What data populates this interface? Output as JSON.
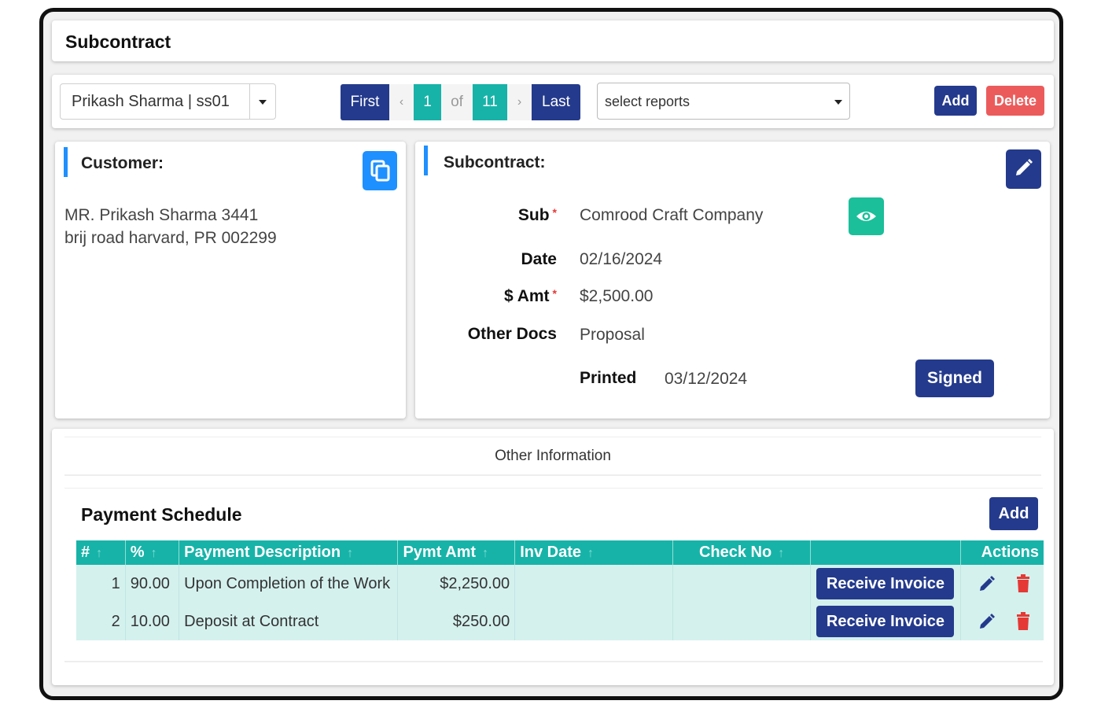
{
  "header": {
    "title": "Subcontract"
  },
  "toolbar": {
    "customer_select": "Prikash Sharma | ss01",
    "pagination": {
      "first": "First",
      "prev": "‹",
      "current": "1",
      "of": "of",
      "total": "11",
      "next": "›",
      "last": "Last"
    },
    "reports_placeholder": "select reports",
    "add_label": "Add",
    "delete_label": "Delete"
  },
  "customer": {
    "heading": "Customer:",
    "address_line1": "MR. Prikash Sharma 3441",
    "address_line2": "brij road harvard, PR 002299"
  },
  "subcontract": {
    "heading": "Subcontract:",
    "sub_label": "Sub",
    "sub_value": "Comrood Craft Company",
    "date_label": "Date",
    "date_value": "02/16/2024",
    "amt_label": "$ Amt",
    "amt_value": "$2,500.00",
    "docs_label": "Other Docs",
    "docs_value": "Proposal",
    "printed_label": "Printed",
    "printed_value": "03/12/2024",
    "signed_label": "Signed",
    "required_mark": "*"
  },
  "other_info": {
    "label": "Other Information"
  },
  "payment_schedule": {
    "title": "Payment Schedule",
    "add_label": "Add",
    "columns": [
      "#",
      "%",
      "Payment Description",
      "Pymt Amt",
      "Inv Date",
      "Check No",
      "",
      "Actions"
    ],
    "rows": [
      {
        "num": "1",
        "pct": "90.00",
        "desc": "Upon Completion of the Work",
        "amt": "$2,250.00",
        "inv_date": "",
        "check_no": "",
        "button": "Receive Invoice"
      },
      {
        "num": "2",
        "pct": "10.00",
        "desc": "Deposit at Contract",
        "amt": "$250.00",
        "inv_date": "",
        "check_no": "",
        "button": "Receive Invoice"
      }
    ]
  },
  "colors": {
    "navy": "#243a8c",
    "teal": "#17b3a8",
    "red": "#ec5b5b",
    "blue": "#1e90ff",
    "green": "#1bbf9a"
  },
  "icons": [
    "copy-icon",
    "pencil-icon",
    "eye-icon",
    "sort-arrow-icon",
    "trash-icon",
    "chevron-down-icon"
  ]
}
